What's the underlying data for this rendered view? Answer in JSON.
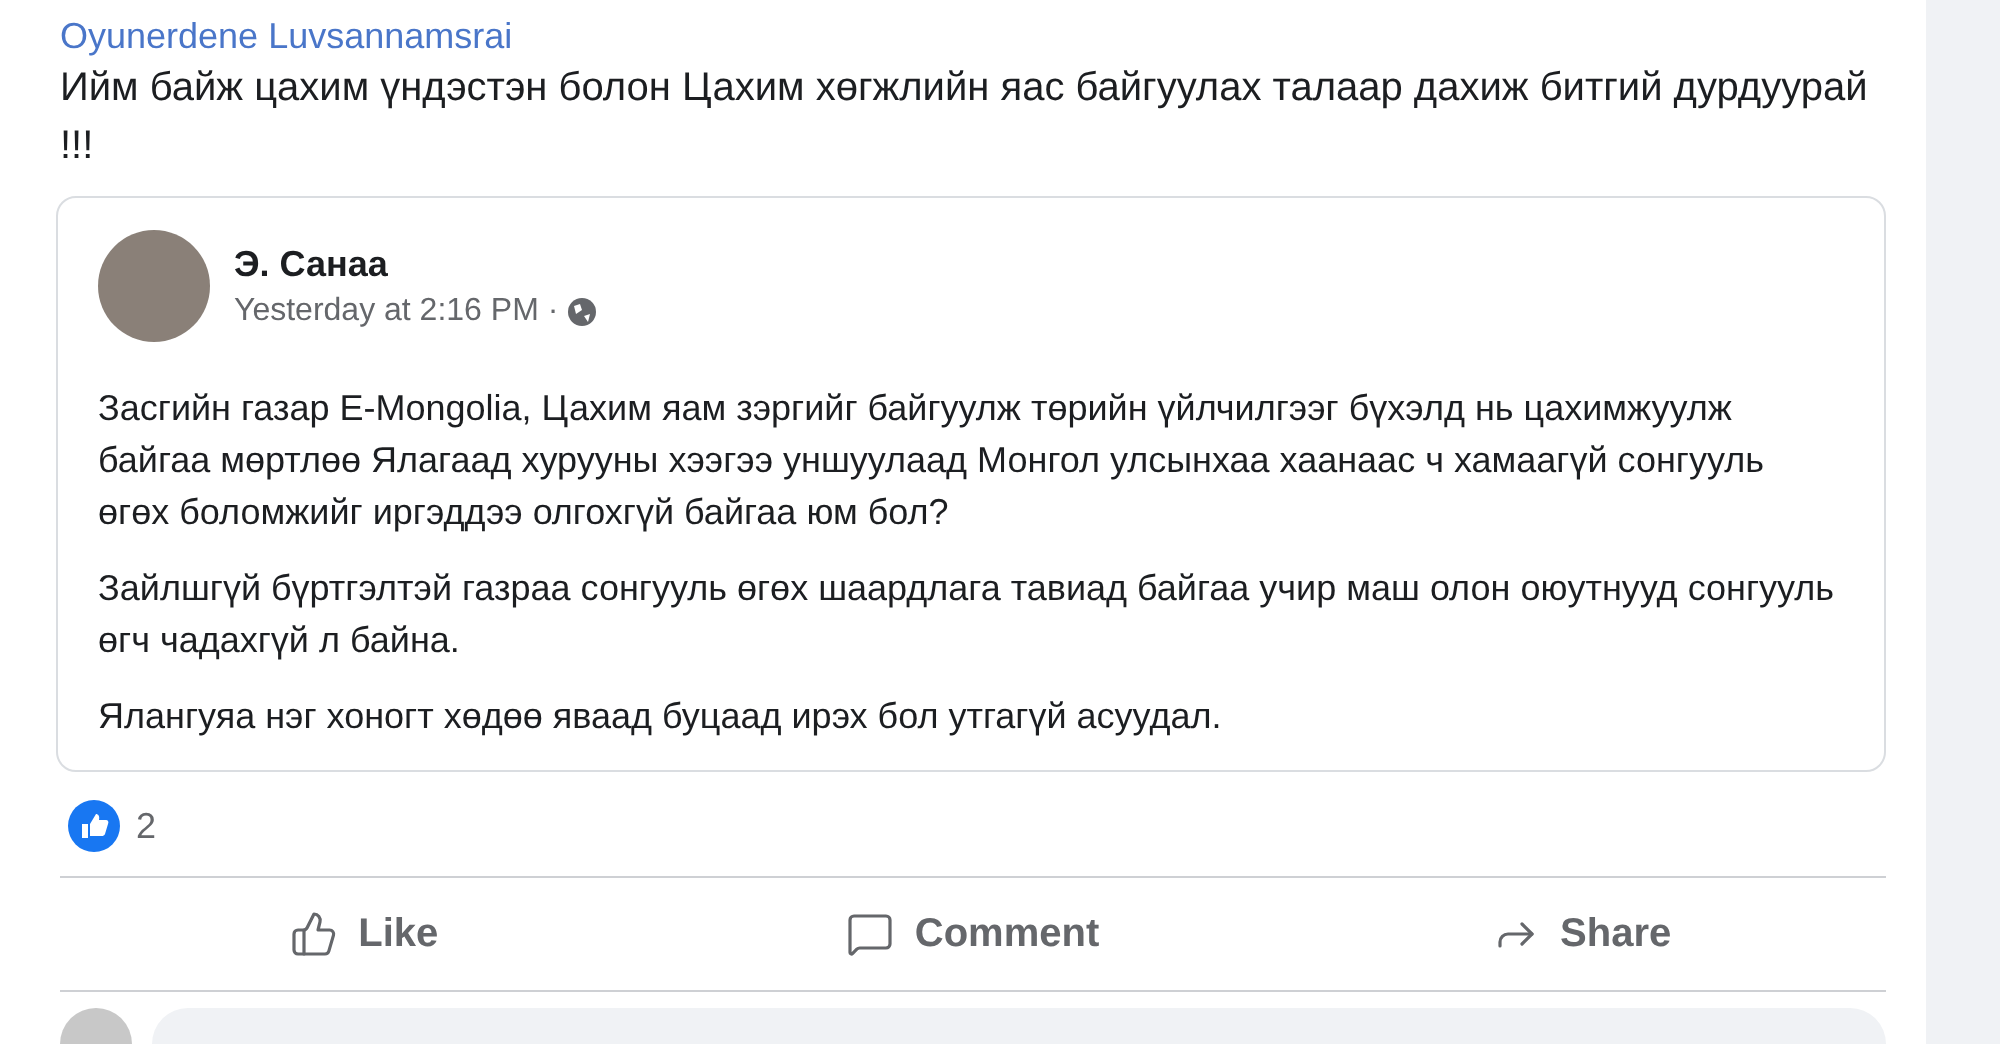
{
  "post": {
    "author": "Oyunerdene Luvsannamsrai",
    "text": "Ийм байж цахим үндэстэн болон Цахим хөгжлийн яас байгуулах талаар дахиж битгий дурдуурай !!!"
  },
  "shared_post": {
    "author": "Э. Санаа",
    "time": "Yesterday at 2:16 PM ·",
    "paragraphs": [
      "Засгийн газар E-Mongolia, Цахим яам зэргийг байгуулж төрийн үйлчилгээг бүхэлд нь цахимжуулж байгаа мөртлөө Ялагаад хурууны хээгээ уншуулаад Монгол улсынхаа хаанаас ч хамаагүй сонгууль өгөх боломжийг иргэддээ олгохгүй байгаа юм бол?",
      "Зайлшгүй бүртгэлтэй газраа сонгууль өгөх шаардлага тавиад байгаа учир маш олон оюутнууд сонгууль өгч чадахгүй л байна.",
      "Ялангуяа нэг хоногт хөдөө яваад буцаад ирэх бол утгагүй асуудал."
    ]
  },
  "reactions": {
    "count": "2"
  },
  "actions": [
    {
      "kind": "like",
      "label": "Like"
    },
    {
      "kind": "comment",
      "label": "Comment"
    },
    {
      "kind": "share",
      "label": "Share"
    }
  ]
}
